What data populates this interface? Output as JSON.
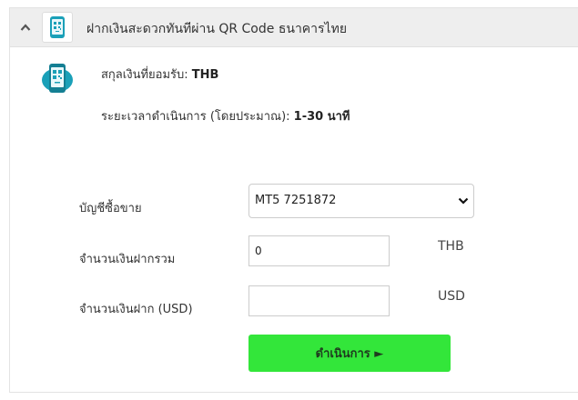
{
  "header": {
    "title": "ฝากเงินสะดวกทันทีผ่าน QR Code ธนาคารไทย",
    "icon": "phone-qr-icon",
    "toggle_icon": "chevron-up-icon"
  },
  "info": {
    "currency_label": "สกุลเงินที่ยอมรับ:",
    "currency_value": "THB",
    "time_label": "ระยะเวลาดำเนินการ (โดยประมาณ):",
    "time_value": "1-30 นาที"
  },
  "form": {
    "account_label": "บัญชีซื้อขาย",
    "account_value": "MT5 7251872",
    "total_label": "จำนวนเงินฝากรวม",
    "total_value": "0",
    "total_currency": "THB",
    "usd_label": "จำนวนเงินฝาก (USD)",
    "usd_value": "",
    "usd_currency": "USD",
    "submit_label": "ดำเนินการ ►"
  },
  "colors": {
    "accent": "#33e63a",
    "icon_teal": "#1aa0b8",
    "header_bg": "#eeeeee"
  }
}
